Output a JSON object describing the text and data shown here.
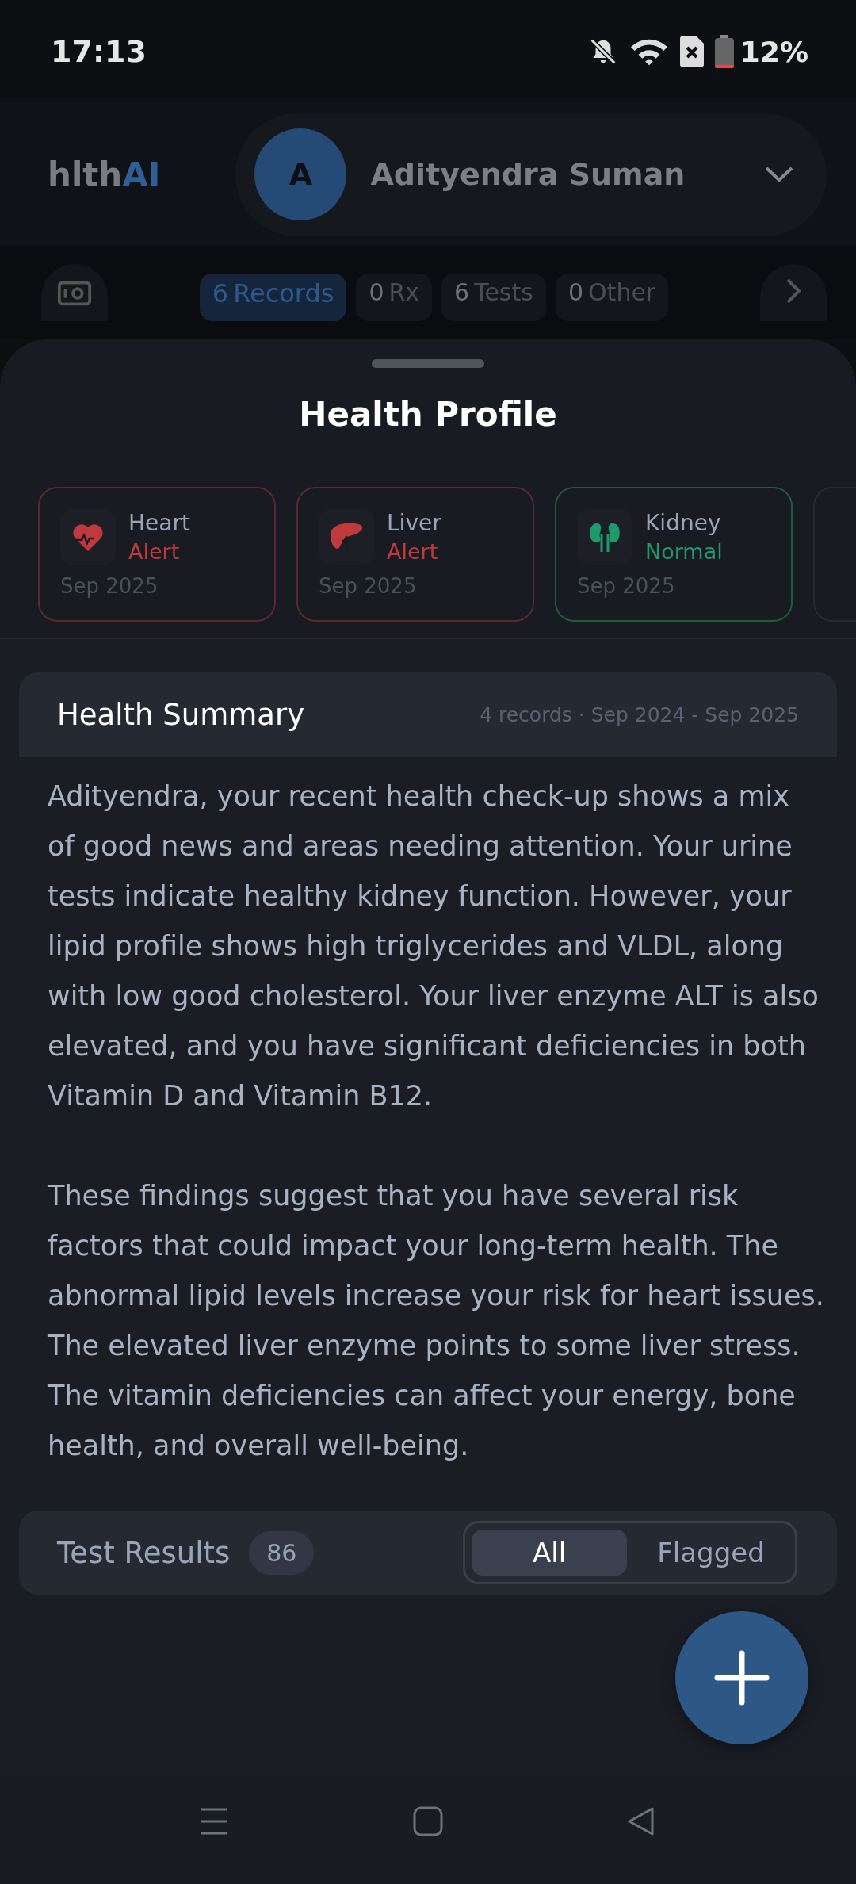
{
  "status_bar": {
    "time": "17:13",
    "battery": "12%"
  },
  "header": {
    "logo": {
      "text": "hlth",
      "accent": "AI"
    },
    "profile": {
      "initial": "A",
      "name": "Adityendra Suman"
    }
  },
  "record_filters": [
    {
      "count": "6",
      "label": "Records",
      "selected": true
    },
    {
      "count": "0",
      "label": "Rx",
      "selected": false
    },
    {
      "count": "6",
      "label": "Tests",
      "selected": false
    },
    {
      "count": "0",
      "label": "Other",
      "selected": false
    }
  ],
  "sheet": {
    "title": "Health Profile",
    "organ_cards": [
      {
        "kind": "heart",
        "name": "Heart",
        "status": "Alert",
        "alert": true,
        "date": "Sep 2025"
      },
      {
        "kind": "liver",
        "name": "Liver",
        "status": "Alert",
        "alert": true,
        "date": "Sep 2025"
      },
      {
        "kind": "kidney",
        "name": "Kidney",
        "status": "Normal",
        "alert": false,
        "date": "Sep 2025"
      }
    ],
    "summary": {
      "title": "Health Summary",
      "meta": "4 records · Sep 2024 - Sep 2025",
      "paragraphs": [
        "Adityendra, your recent health check-up shows a mix of good news and areas needing attention. Your urine tests indicate healthy kidney function. However, your lipid profile shows high triglycerides and VLDL, along with low good cholesterol. Your liver enzyme ALT is also elevated, and you have significant deficiencies in both Vitamin D and Vitamin B12.",
        "These findings suggest that you have several risk factors that could impact your long-term health. The abnormal lipid levels increase your risk for heart issues. The elevated liver enzyme points to some liver stress. The vitamin deficiencies can affect your energy, bone health, and overall well-being."
      ]
    },
    "test_results": {
      "title": "Test Results",
      "count": "86",
      "filters": [
        {
          "label": "All",
          "selected": true
        },
        {
          "label": "Flagged",
          "selected": false
        }
      ]
    }
  }
}
